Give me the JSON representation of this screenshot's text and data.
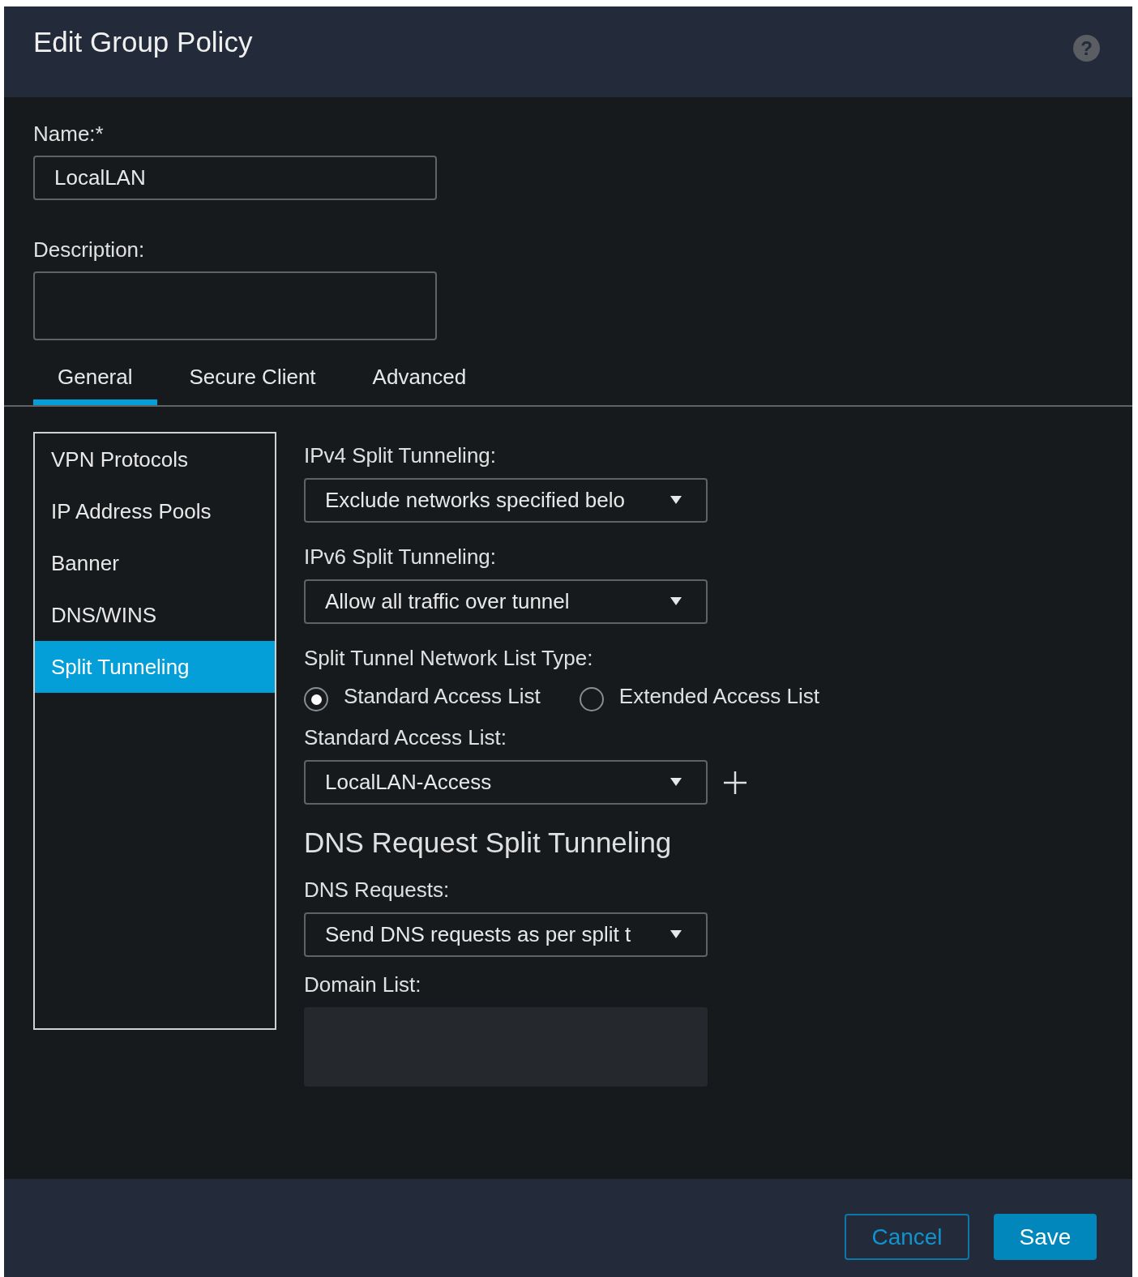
{
  "dialog": {
    "title": "Edit Group Policy",
    "help": "?"
  },
  "name": {
    "label": "Name:*",
    "value": "LocalLAN"
  },
  "description": {
    "label": "Description:"
  },
  "tabs": [
    {
      "label": "General",
      "selected": true
    },
    {
      "label": "Secure Client",
      "selected": false
    },
    {
      "label": "Advanced",
      "selected": false
    }
  ],
  "sidebar": {
    "items": [
      {
        "label": "VPN Protocols",
        "selected": false
      },
      {
        "label": "IP Address Pools",
        "selected": false
      },
      {
        "label": "Banner",
        "selected": false
      },
      {
        "label": "DNS/WINS",
        "selected": false
      },
      {
        "label": "Split Tunneling",
        "selected": true
      }
    ]
  },
  "ipv4": {
    "label": "IPv4 Split Tunneling:",
    "value": "Exclude networks specified belo"
  },
  "ipv6": {
    "label": "IPv6 Split Tunneling:",
    "value": "Allow all traffic over tunnel"
  },
  "list_type": {
    "label": "Split Tunnel Network List Type:",
    "options": [
      {
        "label": "Standard Access List",
        "selected": true
      },
      {
        "label": "Extended Access List",
        "selected": false
      }
    ]
  },
  "standard_access_list": {
    "label": "Standard Access List:",
    "value": "LocalLAN-Access"
  },
  "dns_section": {
    "heading": "DNS Request Split Tunneling",
    "requests_label": "DNS Requests:",
    "requests_value": "Send DNS requests as per split t",
    "domain_label": "Domain List:"
  },
  "buttons": [
    {
      "label": "Cancel",
      "kind": "secondary"
    },
    {
      "label": "Save",
      "kind": "primary"
    }
  ]
}
